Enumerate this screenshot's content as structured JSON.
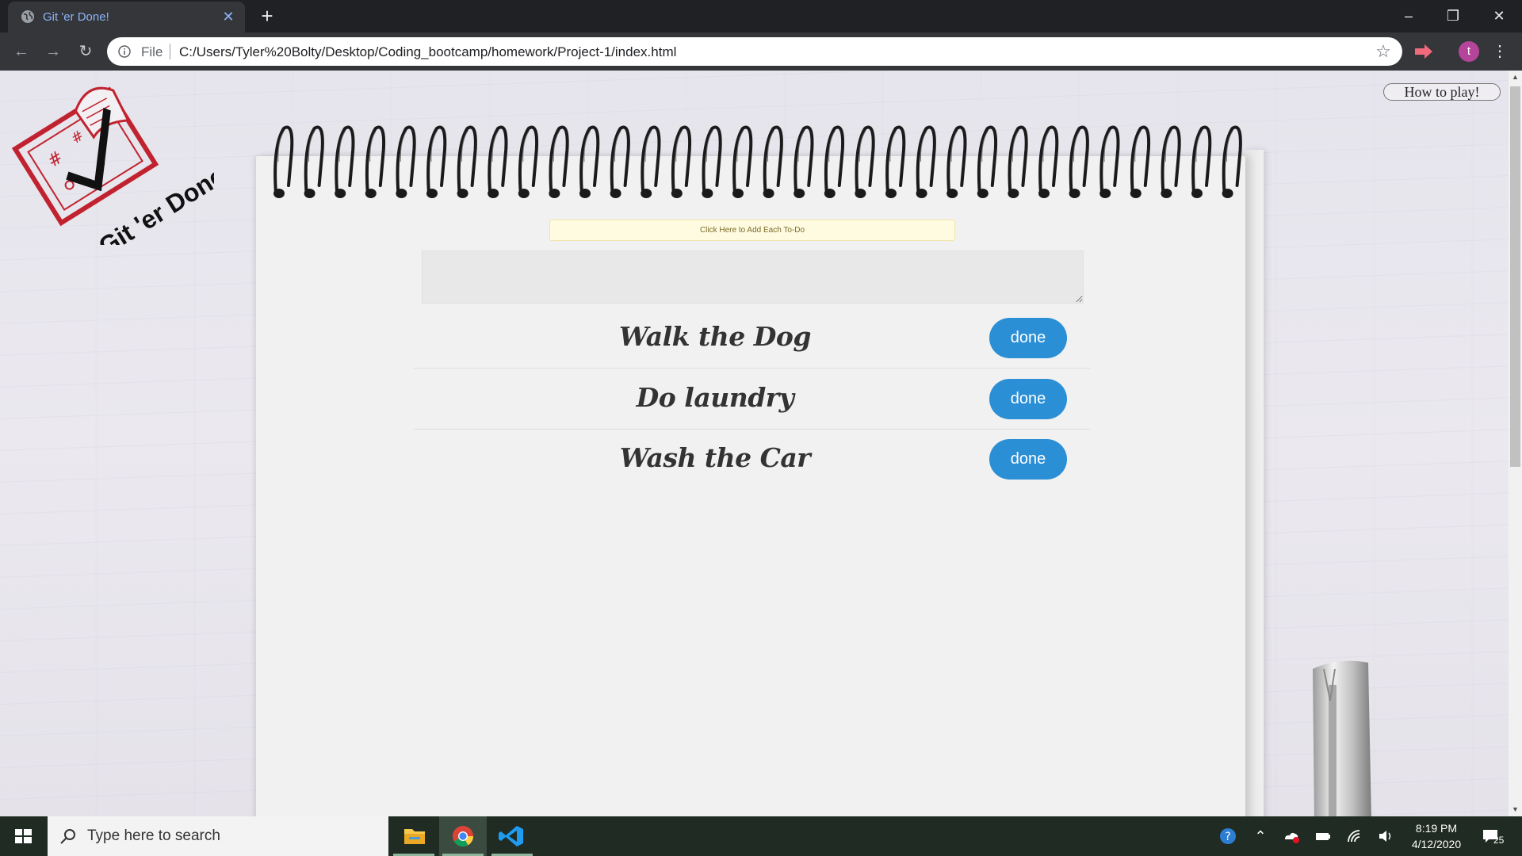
{
  "browser": {
    "tab_title": "Git 'er Done!",
    "file_label": "File",
    "url": "C:/Users/Tyler%20Bolty/Desktop/Coding_bootcamp/homework/Project-1/index.html",
    "profile_initial": "t"
  },
  "page": {
    "logo_text": "Git 'er Done!",
    "how_to_play": "How to play!",
    "add_button_label": "Click Here to Add Each To-Do",
    "input_value": "",
    "todos": [
      {
        "text": "Walk the Dog",
        "button": "done"
      },
      {
        "text": "Do laundry",
        "button": "done"
      },
      {
        "text": "Wash the Car",
        "button": "done"
      }
    ]
  },
  "taskbar": {
    "search_placeholder": "Type here to search",
    "time": "8:19 PM",
    "date": "4/12/2020",
    "notification_count": "25",
    "apps": [
      "file-explorer-icon",
      "chrome-icon",
      "vscode-icon"
    ]
  },
  "colors": {
    "done_button": "#2b8fd6",
    "add_button_bg": "#fffbe0",
    "logo_red": "#c0232f"
  }
}
